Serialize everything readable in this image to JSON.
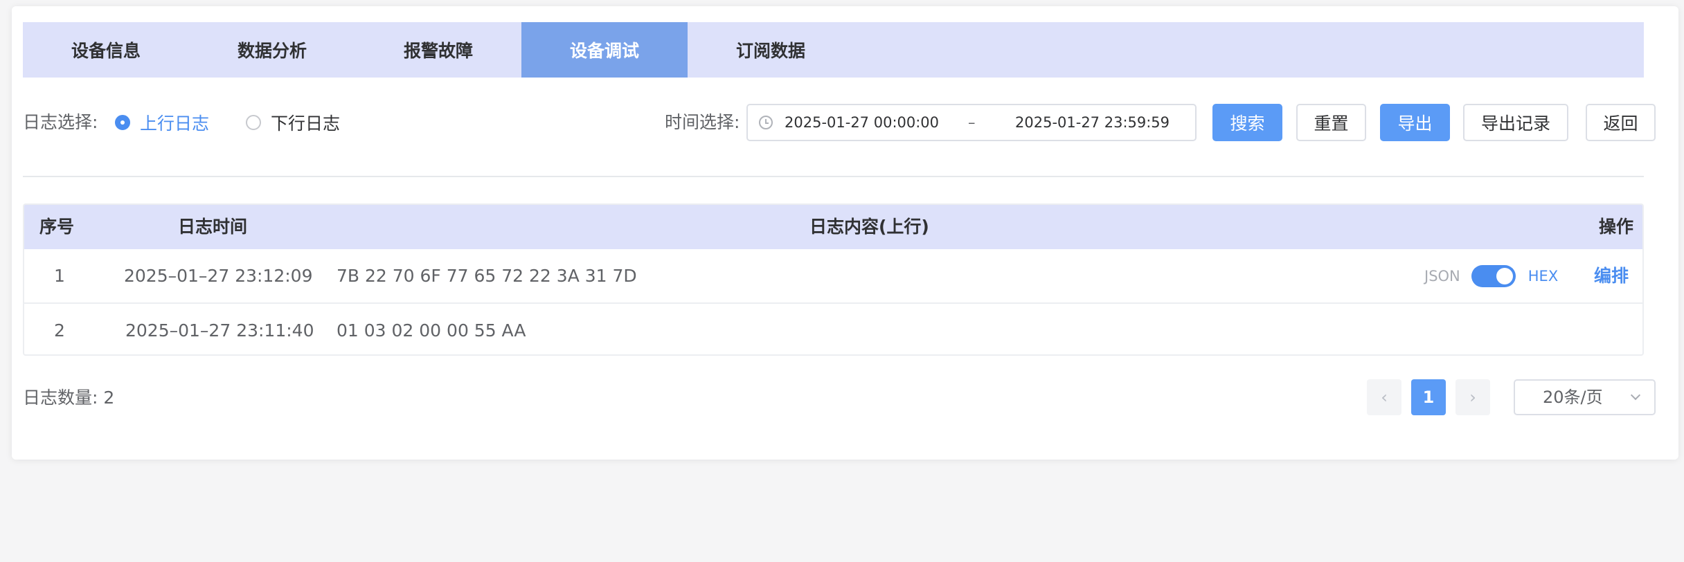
{
  "tabs": [
    {
      "label": "设备信息"
    },
    {
      "label": "数据分析"
    },
    {
      "label": "报警故障"
    },
    {
      "label": "设备调试",
      "active": true
    },
    {
      "label": "订阅数据"
    }
  ],
  "filter": {
    "log_select_label": "日志选择:",
    "radio_up": "上行日志",
    "radio_down": "下行日志",
    "selected": "上行日志",
    "time_select_label": "时间选择:",
    "start_time": "2025-01-27 00:00:00",
    "separator": "–",
    "end_time": "2025-01-27 23:59:59",
    "buttons": {
      "search": "搜索",
      "reset": "重置",
      "export": "导出",
      "export_records": "导出记录",
      "back": "返回"
    }
  },
  "table": {
    "headers": {
      "index": "序号",
      "time": "日志时间",
      "content": "日志内容(上行)",
      "action": "操作"
    },
    "rows": [
      {
        "index": "1",
        "time": "2025–01–27 23:12:09",
        "content": "7B 22 70 6F 77 65 72 22 3A 31 7D",
        "switch_left": "JSON",
        "switch_right": "HEX",
        "action": "编排"
      },
      {
        "index": "2",
        "time": "2025–01–27 23:11:40",
        "content": "01 03 02 00 00 55 AA"
      }
    ]
  },
  "footer": {
    "count_label": "日志数量: 2",
    "current_page": "1",
    "page_size": "20条/页"
  },
  "colors": {
    "accent": "#5b9bf6",
    "tab_bg": "#dde1fa",
    "tab_active": "#7aa3ea"
  }
}
